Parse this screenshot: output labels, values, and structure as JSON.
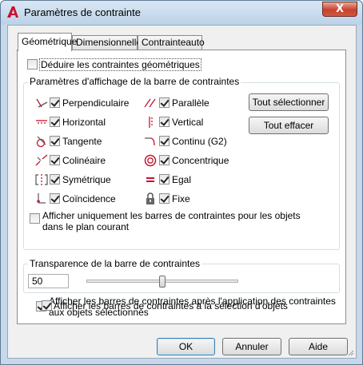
{
  "window": {
    "title": "Paramètres de contrainte",
    "close_label": "X"
  },
  "tabs": [
    {
      "label": "Géométrique",
      "active": true
    },
    {
      "label": "Dimensionnelle",
      "active": false
    },
    {
      "label": "Contrainteauto",
      "active": false
    }
  ],
  "infer": {
    "label": "Déduire les contraintes géométriques",
    "checked": false
  },
  "display_group": {
    "title": "Paramètres d'affichage de la barre de contraintes",
    "constraints": [
      {
        "label": "Perpendiculaire",
        "icon": "perpendicular-icon",
        "checked": true
      },
      {
        "label": "Horizontal",
        "icon": "horizontal-icon",
        "checked": true
      },
      {
        "label": "Tangente",
        "icon": "tangent-icon",
        "checked": true
      },
      {
        "label": "Colinéaire",
        "icon": "collinear-icon",
        "checked": true
      },
      {
        "label": "Symétrique",
        "icon": "symmetric-icon",
        "checked": true
      },
      {
        "label": "Coïncidence",
        "icon": "coincident-icon",
        "checked": true
      },
      {
        "label": "Parallèle",
        "icon": "parallel-icon",
        "checked": true
      },
      {
        "label": "Vertical",
        "icon": "vertical-icon",
        "checked": true
      },
      {
        "label": "Continu (G2)",
        "icon": "smooth-icon",
        "checked": true
      },
      {
        "label": "Concentrique",
        "icon": "concentric-icon",
        "checked": true
      },
      {
        "label": "Egal",
        "icon": "equal-icon",
        "checked": true
      },
      {
        "label": "Fixe",
        "icon": "lock-icon",
        "checked": true
      }
    ],
    "select_all": "Tout sélectionner",
    "clear_all": "Tout effacer",
    "only_current_plane": {
      "line1": "Afficher uniquement les barres de contraintes pour les objets",
      "line2": "dans le plan courant",
      "checked": false
    }
  },
  "transparency": {
    "title": "Transparence de la barre de contraintes",
    "value": "50",
    "slider_fraction": 0.5
  },
  "after_apply": {
    "line1": "Afficher les barres de contraintes après l'application des contraintes",
    "line2": "aux objets sélectionnés",
    "checked": true
  },
  "on_select": {
    "label": "Afficher les barres de contraintes à la sélection d'objets",
    "checked": true
  },
  "buttons": {
    "ok": "OK",
    "cancel": "Annuler",
    "help": "Aide"
  },
  "colors": {
    "icon_red": "#c8102e",
    "title_bar": "#c6d8ea"
  }
}
